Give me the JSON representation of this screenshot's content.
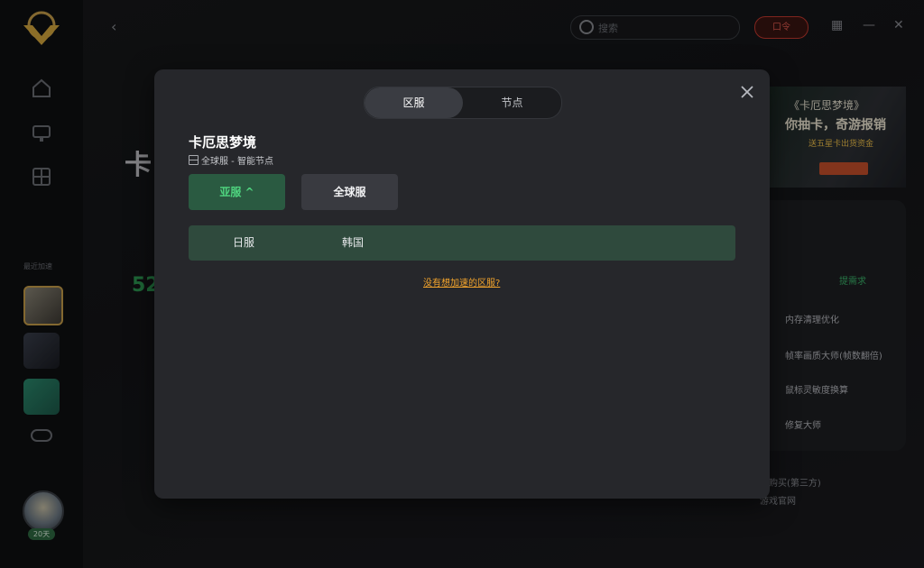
{
  "background": {
    "sidebar": {
      "recent_label": "最近加速",
      "days_badge": "20天"
    },
    "search": {
      "placeholder": "搜索"
    },
    "red_pill": "口令",
    "title_partial": "卡",
    "green_number": "52",
    "banner": {
      "line1": "《卡厄思梦境》",
      "line2": "你抽卡，奇游报销",
      "line3": "送五星卡出货资金"
    },
    "tools_tag": "提需求",
    "tools": [
      "内存清理优化",
      "帧率画质大师(帧数翻倍)",
      "鼠标灵敏度换算",
      "修复大师"
    ],
    "links": [
      "游购买(第三方)",
      "游戏官网"
    ]
  },
  "modal": {
    "tabs": [
      {
        "label": "区服",
        "active": true
      },
      {
        "label": "节点",
        "active": false
      }
    ],
    "game_title": "卡厄思梦境",
    "subtitle": "全球服 - 智能节点",
    "regions": [
      {
        "label": "亚服 ^",
        "selected": true
      },
      {
        "label": "全球服",
        "selected": false
      }
    ],
    "sub_regions": [
      "日服",
      "韩国"
    ],
    "help_link": "没有想加速的区服?"
  },
  "colors": {
    "accent_green": "#4fd47f",
    "selected_region_bg": "#2a5a41",
    "sub_row_bg": "#2f4a3d",
    "link_orange": "#f1a32c",
    "modal_bg": "#26272b"
  }
}
